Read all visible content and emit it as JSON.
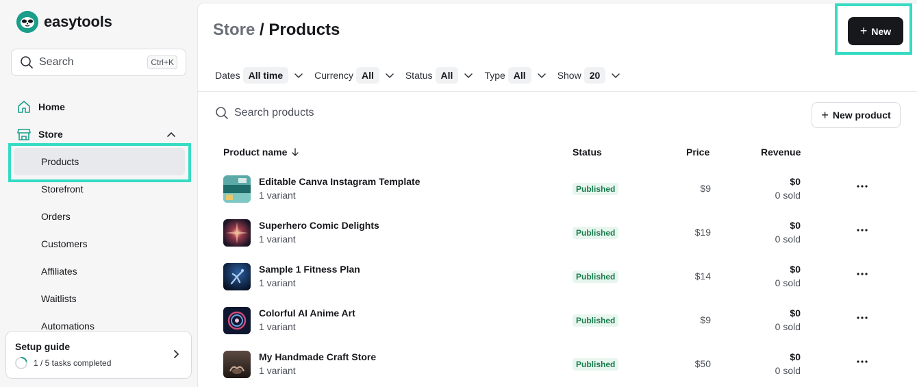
{
  "app": {
    "logo_text": "easytools"
  },
  "sidebar": {
    "search_label": "Search",
    "search_shortcut": "Ctrl+K",
    "home_label": "Home",
    "store_label": "Store",
    "store_items": [
      "Products",
      "Storefront",
      "Orders",
      "Customers",
      "Affiliates",
      "Waitlists",
      "Automations"
    ],
    "active_item": "Products",
    "setup_title": "Setup guide",
    "setup_progress": "1 / 5 tasks completed",
    "setup_progress_fraction": 0.2
  },
  "header": {
    "breadcrumb_parent": "Store",
    "breadcrumb_sep": " / ",
    "title": "Products",
    "new_button": "New"
  },
  "filters": [
    {
      "label": "Dates",
      "value": "All time"
    },
    {
      "label": "Currency",
      "value": "All"
    },
    {
      "label": "Status",
      "value": "All"
    },
    {
      "label": "Type",
      "value": "All"
    },
    {
      "label": "Show",
      "value": "20"
    }
  ],
  "products_toolbar": {
    "search_placeholder": "Search products",
    "new_product_button": "New product"
  },
  "table": {
    "columns": {
      "name": "Product name",
      "status": "Status",
      "price": "Price",
      "revenue": "Revenue"
    },
    "rows": [
      {
        "name": "Editable Canva Instagram Template",
        "variants": "1 variant",
        "status": "Published",
        "price": "$9",
        "revenue": "$0",
        "sold": "0 sold"
      },
      {
        "name": "Superhero Comic Delights",
        "variants": "1 variant",
        "status": "Published",
        "price": "$19",
        "revenue": "$0",
        "sold": "0 sold"
      },
      {
        "name": "Sample 1 Fitness Plan",
        "variants": "1 variant",
        "status": "Published",
        "price": "$14",
        "revenue": "$0",
        "sold": "0 sold"
      },
      {
        "name": "Colorful AI Anime Art",
        "variants": "1 variant",
        "status": "Published",
        "price": "$9",
        "revenue": "$0",
        "sold": "0 sold"
      },
      {
        "name": "My Handmade Craft Store",
        "variants": "1 variant",
        "status": "Published",
        "price": "$50",
        "revenue": "$0",
        "sold": "0 sold"
      }
    ]
  },
  "colors": {
    "accent_highlight": "#35dcc3",
    "brand": "#1a9e8a",
    "primary_button": "#17181c",
    "published_badge_text": "#1a7b4d",
    "published_badge_bg": "#e7f6ee"
  }
}
